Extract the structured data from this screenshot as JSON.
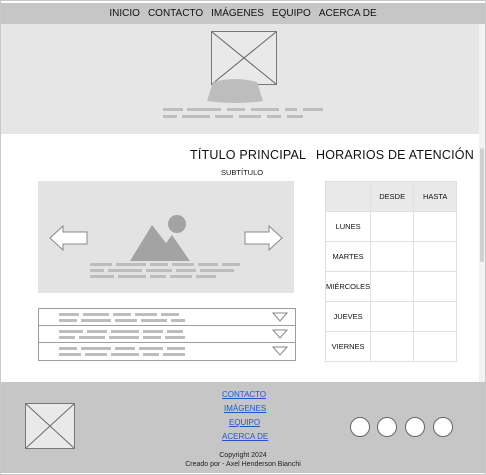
{
  "nav": {
    "items": [
      "INICIO",
      "CONTACTO",
      "IMÁGENES",
      "EQUIPO",
      "ACERCA DE"
    ]
  },
  "main": {
    "title": "TÍTULO PRINCIPAL",
    "subtitle": "SUBTÍTULO"
  },
  "hours": {
    "title": "HORARIOS DE ATENCIÓN",
    "columns": [
      "",
      "DESDE",
      "HASTA"
    ],
    "days": [
      "LUNES",
      "MARTES",
      "MIÉRCOLES",
      "JUEVES",
      "VIERNES"
    ]
  },
  "footer": {
    "links": [
      "CONTACTO",
      "IMÁGENES",
      "EQUIPO",
      "ACERCA DE"
    ],
    "copyright": "Copyright 2024",
    "credit": "Creado por - Axel Henderson Bianchi"
  },
  "icons": {
    "hero_image": "image-placeholder-icon",
    "carousel_image": "image-icon",
    "footer_logo": "image-placeholder-icon",
    "accordion_toggle": "triangle-down-icon",
    "carousel_prev": "arrow-left-icon",
    "carousel_next": "arrow-right-icon",
    "social": "circle-icon"
  }
}
